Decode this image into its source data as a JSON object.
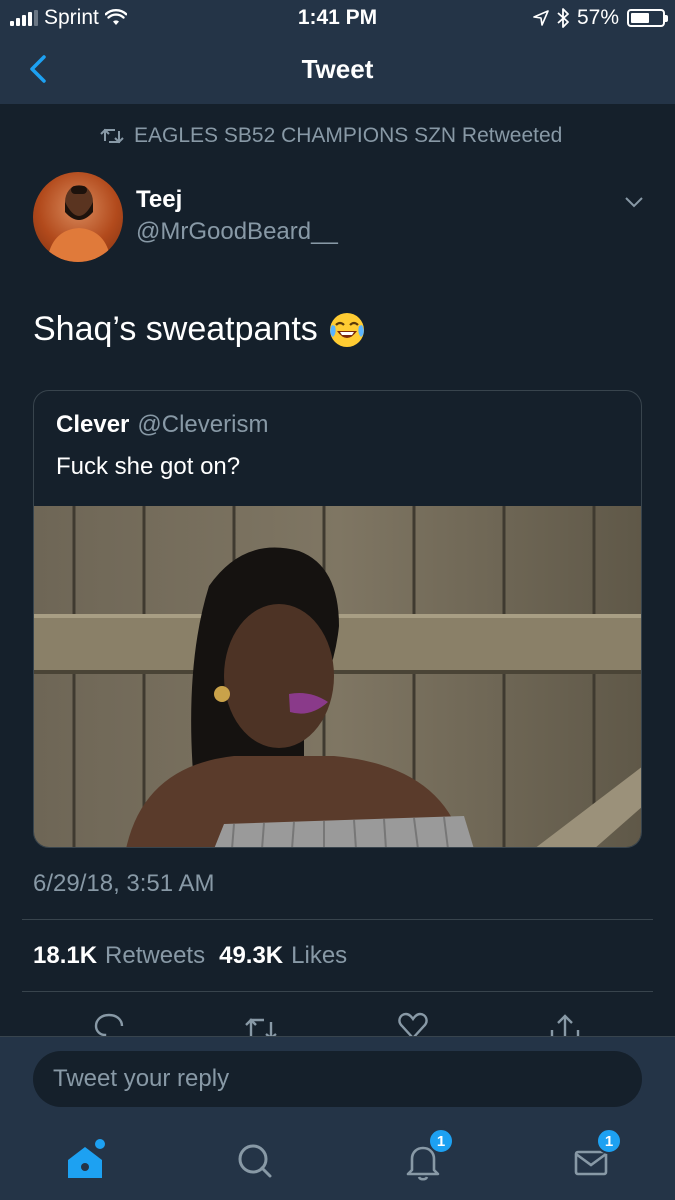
{
  "status_bar": {
    "carrier": "Sprint",
    "time": "1:41 PM",
    "battery": "57%"
  },
  "header": {
    "title": "Tweet"
  },
  "retweeted_by": "EAGLES SB52 CHAMPIONS SZN Retweeted",
  "tweet": {
    "author_name": "Teej",
    "author_handle": "@MrGoodBeard__",
    "text": "Shaq’s sweatpants",
    "emoji": "face-with-tears-of-joy",
    "quoted": {
      "name": "Clever",
      "handle": "@Cleverism",
      "text": "Fuck she got on?"
    },
    "timestamp": "6/29/18, 3:51 AM",
    "retweets_count": "18.1K",
    "retweets_label": "Retweets",
    "likes_count": "49.3K",
    "likes_label": "Likes"
  },
  "actions": [
    "reply-icon",
    "retweet-icon",
    "like-icon",
    "share-icon"
  ],
  "reply": {
    "placeholder": "Tweet your reply"
  },
  "tab_bar": {
    "notifications_badge": "1",
    "messages_badge": "1"
  },
  "colors": {
    "background": "#15202b",
    "bars": "#243447",
    "accent": "#1da1f2",
    "secondary_text": "#8899a6"
  }
}
